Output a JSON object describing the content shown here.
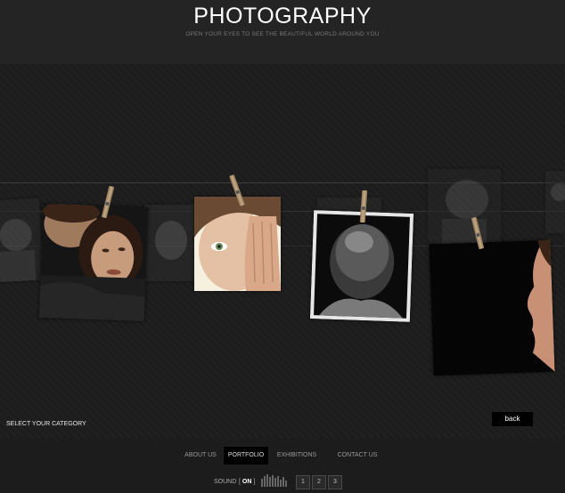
{
  "header": {
    "title": "PHOTOGRAPHY",
    "subtitle": "OPEN YOUR EYES TO SEE THE BEAUTIFUL WORLD AROUND YOU"
  },
  "gallery": {
    "select_category": "SELECT YOUR CATEGORY",
    "back_label": "back"
  },
  "nav": {
    "items": [
      {
        "label": "ABOUT US"
      },
      {
        "label": "PORTFOLIO",
        "active": true
      },
      {
        "label": "EXHIBITIONS"
      },
      {
        "label": "CONTACT US"
      }
    ]
  },
  "sound": {
    "label": "SOUND",
    "state": "ON"
  },
  "pages": [
    "1",
    "2",
    "3"
  ],
  "colors": {
    "background": "#1a1a1a",
    "header": "#242424",
    "accent": "#000000"
  }
}
